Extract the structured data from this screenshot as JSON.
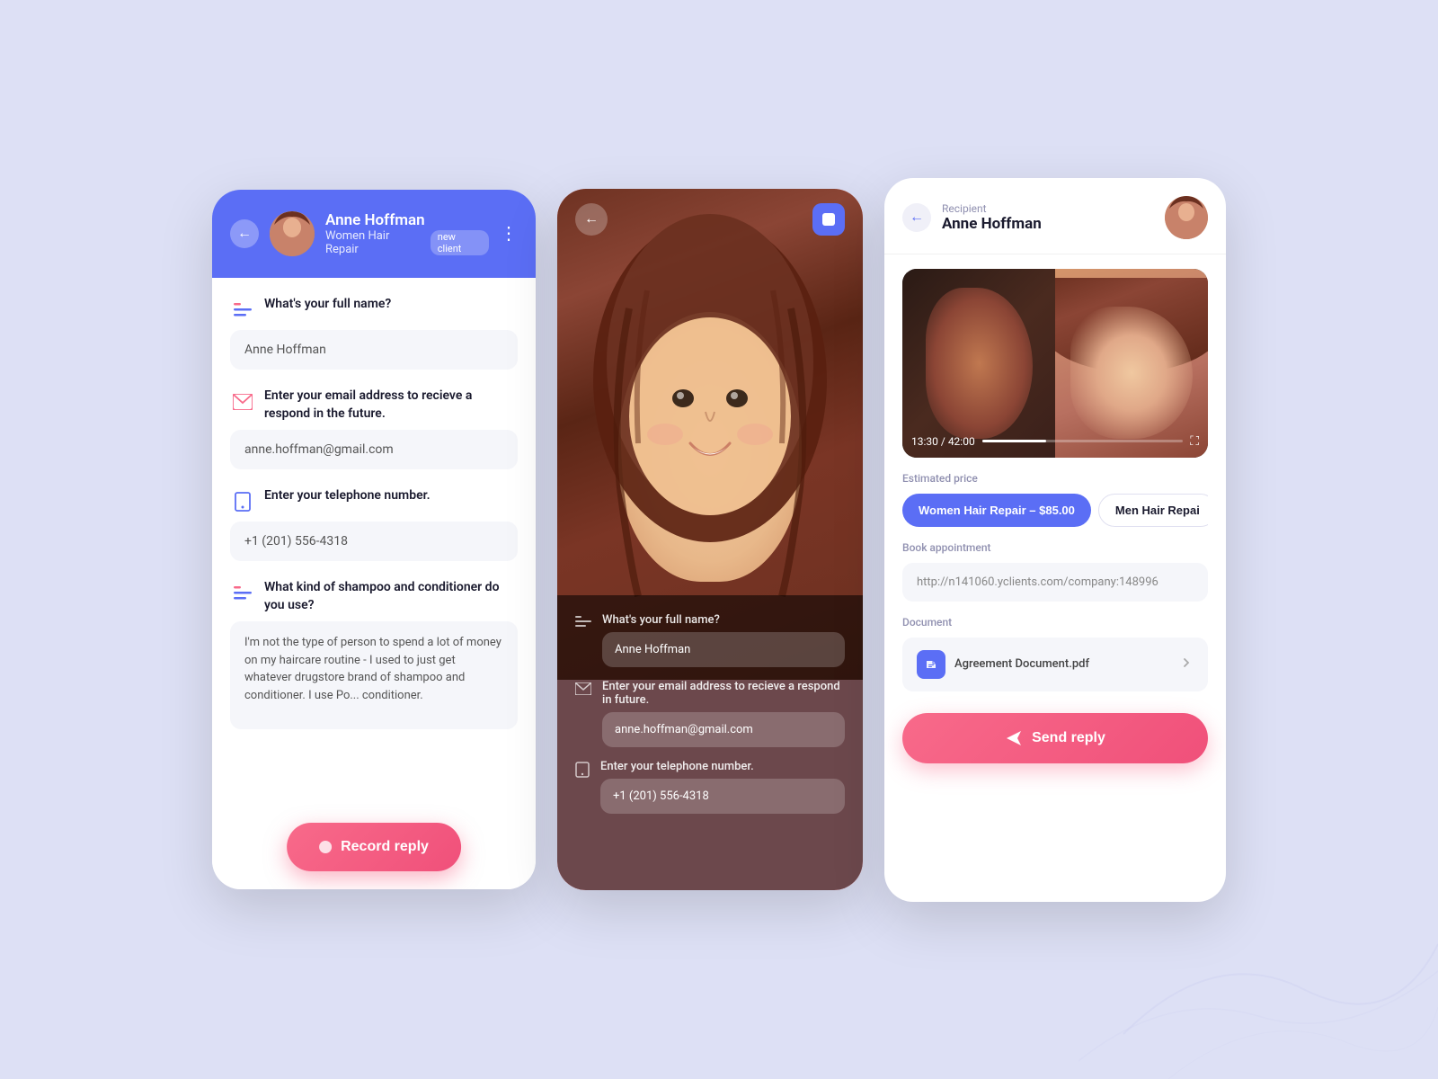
{
  "background": {
    "color": "#dde0f5"
  },
  "phone_left": {
    "header": {
      "name": "Anne Hoffman",
      "subtitle": "Women Hair Repair",
      "badge": "new client",
      "back_icon": "←",
      "more_icon": "⋮"
    },
    "form": {
      "field1": {
        "label": "What's your full name?",
        "value": "Anne Hoffman",
        "icon": "lines"
      },
      "field2": {
        "label": "Enter your email address to recieve a respond in the future.",
        "value": "anne.hoffman@gmail.com",
        "icon": "email"
      },
      "field3": {
        "label": "Enter your telephone number.",
        "value": "+1 (201) 556-4318",
        "icon": "phone"
      },
      "field4": {
        "label": "What kind of shampoo and conditioner do you use?",
        "value": "I'm not the type of person to spend a lot of money on my haircare routine - I used to just get whatever drugstore brand of shampoo and conditioner. I use Po... conditioner.",
        "icon": "lines"
      }
    },
    "record_button": {
      "label": "Record reply",
      "dot": true
    }
  },
  "phone_middle": {
    "nav": {
      "back_icon": "←",
      "stop_icon": "stop"
    },
    "form": {
      "field1": {
        "label": "What's your full name?",
        "value": "Anne Hoffman",
        "icon": "lines"
      },
      "field2": {
        "label": "Enter your email address to recieve a respond in future.",
        "value": "anne.hoffman@gmail.com",
        "icon": "email"
      },
      "field3": {
        "label": "Enter your telephone number.",
        "value": "+1 (201) 556-4318",
        "icon": "phone"
      }
    }
  },
  "phone_right": {
    "header": {
      "recipient_label": "Recipient",
      "name": "Anne Hoffman",
      "back_icon": "←"
    },
    "video": {
      "time_current": "13:30",
      "time_total": "42:00",
      "progress_pct": 32,
      "fullscreen_icon": "⛶"
    },
    "estimated_price": {
      "label": "Estimated price",
      "option1": "Women Hair Repair – $85.00",
      "option2": "Men Hair Repai"
    },
    "book_appointment": {
      "label": "Book appointment",
      "url": "http://n141060.yclients.com/company:148996"
    },
    "document": {
      "label": "Document",
      "filename": "Agreement Document.pdf",
      "icon": "pdf"
    },
    "send_button": {
      "label": "Send reply",
      "icon": "→"
    }
  }
}
